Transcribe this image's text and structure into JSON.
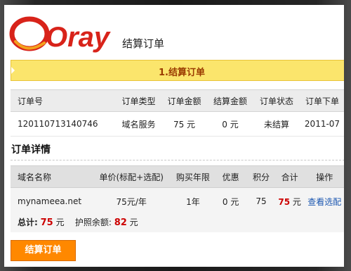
{
  "header": {
    "logo_text": "Oray",
    "page_title": "结算订单"
  },
  "colors": {
    "logo_red": "#d8231a",
    "step_bar": "#fbe56c",
    "price_red": "#cc0000",
    "button_orange": "#ff8800"
  },
  "step": {
    "label": "1.结算订单"
  },
  "order_table": {
    "headers": [
      "订单号",
      "订单类型",
      "订单金额",
      "结算金额",
      "订单状态",
      "订单下单"
    ],
    "row": [
      "120110713140746",
      "域名服务",
      "75 元",
      "0 元",
      "未结算",
      "2011-07"
    ]
  },
  "details": {
    "section_title": "订单详情",
    "headers": [
      "域名名称",
      "单价(标配+选配)",
      "购买年限",
      "优惠",
      "积分",
      "合计",
      "操作"
    ],
    "row": {
      "domain": "mynameea.net",
      "unit_price": "75元/年",
      "years": "1年",
      "discount": "0 元",
      "points": "75",
      "total": "75",
      "total_unit": "元",
      "action": "查看选配"
    },
    "summary": {
      "total_label": "总计:",
      "total_value": "75",
      "total_unit": "元",
      "passport_label": "护照余额:",
      "passport_value": "82",
      "passport_unit": "元"
    }
  },
  "submit_button": {
    "label": "结算订单"
  }
}
